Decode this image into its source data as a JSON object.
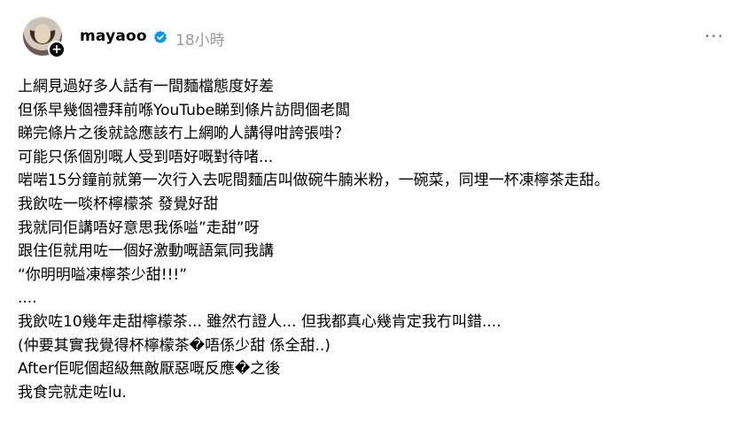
{
  "post": {
    "author": {
      "username": "mayaoo",
      "verified": true,
      "timestamp": "18小時"
    },
    "icons": {
      "verified": "verified-badge-icon",
      "follow": "plus-icon",
      "more": "more-horizontal-icon"
    },
    "more_glyph": "···",
    "follow_glyph": "+",
    "lines": [
      "上網見過好多人話有一間麵檔態度好差",
      "但係早幾個禮拜前喺YouTube睇到條片訪問個老闆",
      "睇完條片之後就諗應該冇上網啲人講得咁誇張啩？",
      "可能只係個別嘅人受到唔好嘅對待啫...",
      "啱啱15分鐘前就第一次行入去呢間麵店叫做碗牛腩米粉，一碗菜，同埋一杯凍檸茶走甜。",
      "我飲咗一啖杯檸檬茶 發覺好甜",
      "我就同佢講唔好意思我係嗌”走甜”呀",
      "跟住佢就用咗一個好激動嘅語氣同我講",
      "“你明明嗌凍檸茶少甜!!!”",
      "....",
      "我飲咗10幾年走甜檸檬茶... 雖然冇證人... 但我都真心幾肯定我冇叫錯....",
      "(仲要其實我覺得杯檸檬茶�唔係少甜 係全甜..)",
      "After佢呢個超級無敵厭惡嘅反應�之後",
      "我食完就走咗lu."
    ]
  }
}
